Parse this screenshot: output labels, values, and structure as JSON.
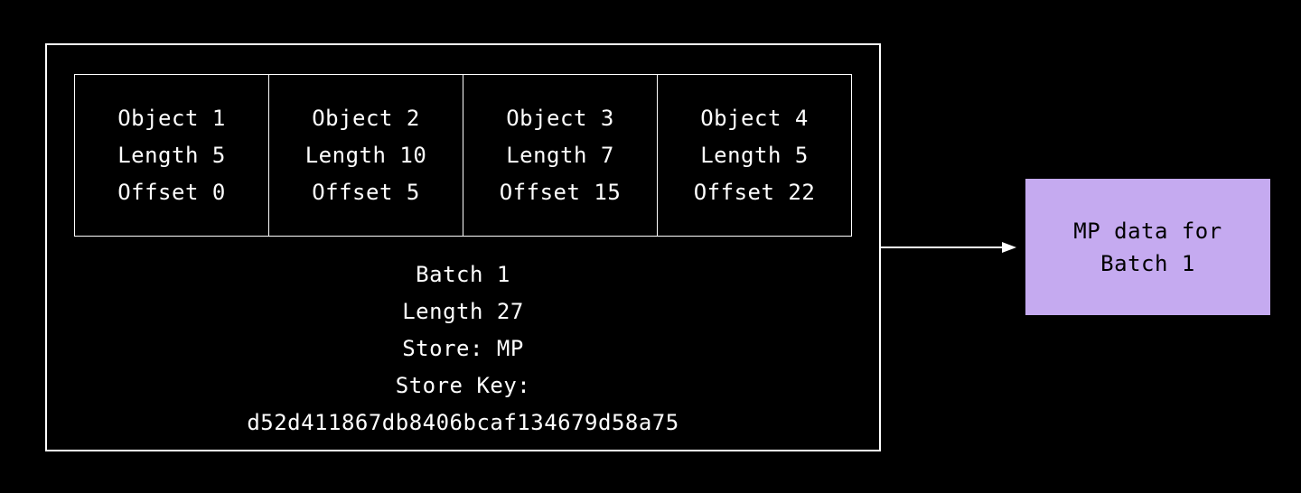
{
  "objects": [
    {
      "name": "Object 1",
      "length": "Length 5",
      "offset": "Offset 0"
    },
    {
      "name": "Object 2",
      "length": "Length 10",
      "offset": "Offset 5"
    },
    {
      "name": "Object 3",
      "length": "Length 7",
      "offset": "Offset 15"
    },
    {
      "name": "Object 4",
      "length": "Length 5",
      "offset": "Offset 22"
    }
  ],
  "batch": {
    "name": "Batch 1",
    "length": "Length 27",
    "store": "Store: MP",
    "store_key_label": "Store Key:",
    "store_key": "d52d411867db8406bcaf134679d58a75"
  },
  "mp_box": {
    "line1": "MP data for",
    "line2": "Batch 1"
  },
  "colors": {
    "bg": "#000000",
    "fg": "#ffffff",
    "accent": "#c5aaf0"
  }
}
